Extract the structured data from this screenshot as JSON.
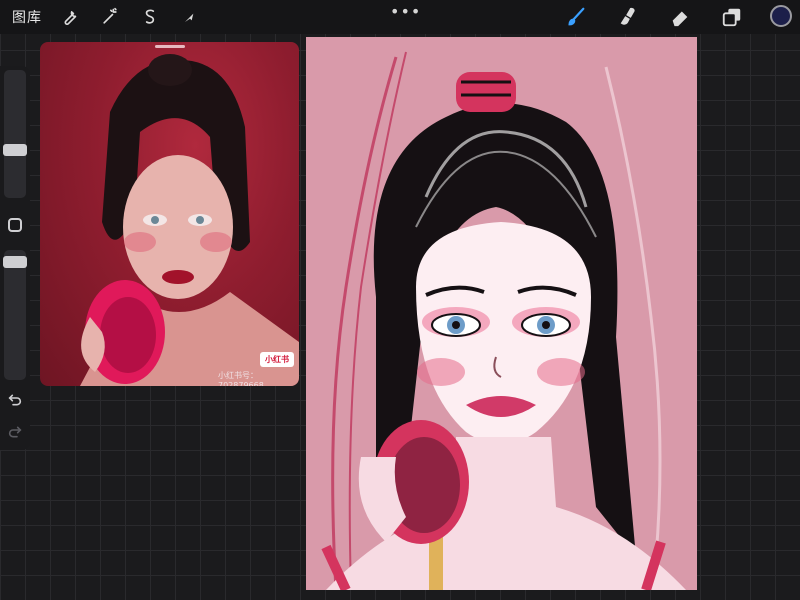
{
  "toolbar": {
    "gallery_label": "图库",
    "more_label": "•••",
    "left_tools": [
      "wrench-icon",
      "magic-wand-icon",
      "selection-icon",
      "transform-icon"
    ],
    "right_tools": [
      "brush-icon",
      "smudge-icon",
      "eraser-icon",
      "layers-icon"
    ],
    "active_tool": "brush-icon",
    "active_color": "#1c1f4a"
  },
  "sidebar": {
    "brush_size_level": 0.55,
    "opacity_level": 0.2
  },
  "reference": {
    "badge_label": "小红书",
    "watermark_label": "小红书号：702879668"
  },
  "colors": {
    "accent": "#3aa0ff",
    "canvas_bg": "#d99aaa",
    "reference_bg": "#8f1d2f"
  }
}
